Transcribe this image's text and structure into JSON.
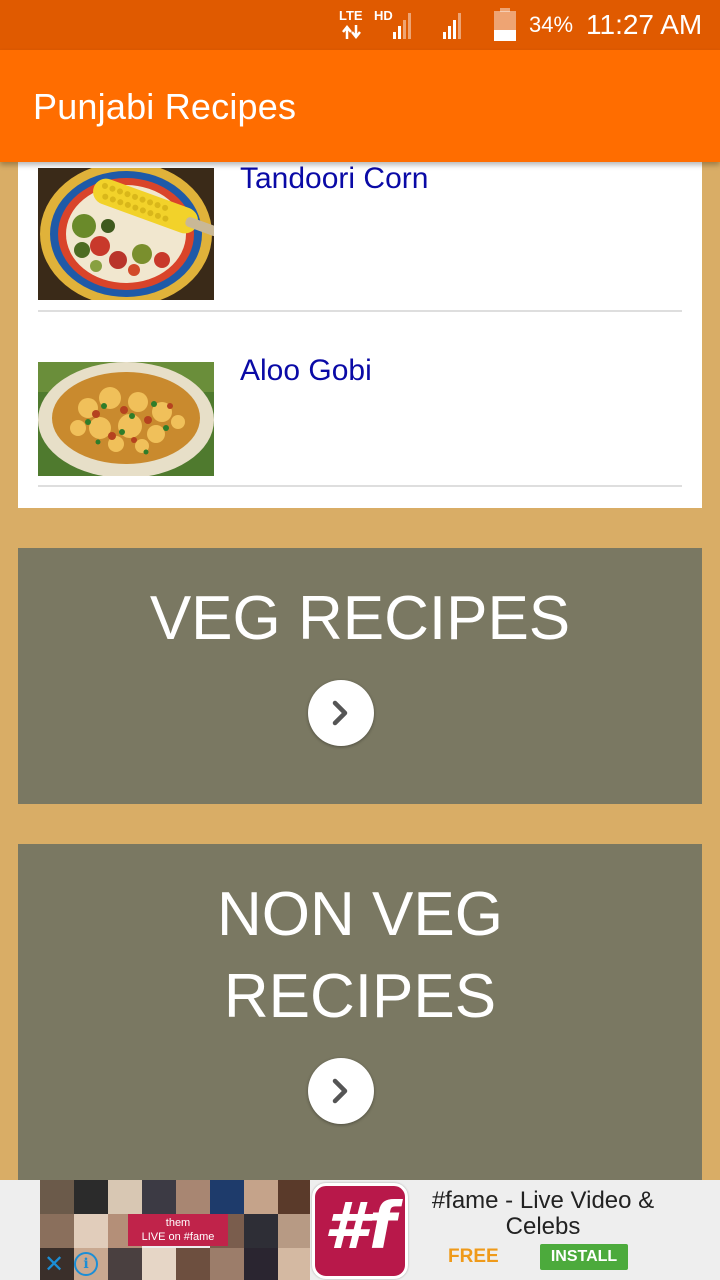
{
  "status_bar": {
    "network_type": "LTE",
    "hd_label": "HD",
    "battery_percent": "34%",
    "time": "11:27 AM",
    "icons": [
      "lte-data-icon",
      "signal-icon",
      "signal-icon",
      "battery-icon"
    ]
  },
  "app_bar": {
    "title": "Punjabi Recipes"
  },
  "recipe_list": {
    "items": [
      {
        "title": "Tandoori Corn",
        "thumbnail": "tandoori-corn-photo"
      },
      {
        "title": "Aloo Gobi",
        "thumbnail": "aloo-gobi-photo"
      }
    ]
  },
  "categories": [
    {
      "title": "VEG RECIPES",
      "button_icon": "chevron-right-icon"
    },
    {
      "title_line1": "NON VEG",
      "title_line2": "RECIPES",
      "button_icon": "chevron-right-icon"
    }
  ],
  "ad": {
    "collage_text_line1": "them",
    "collage_text_line2": "LIVE on #fame",
    "app_icon_letter": "#f",
    "headline": "#fame - Live Video & Celebs",
    "price": "FREE",
    "cta": "INSTALL",
    "close_glyph": "✕",
    "info_glyph": "i"
  },
  "colors": {
    "status_bar": "#e05a00",
    "app_bar": "#ff6d00",
    "background": "#d9ad66",
    "category_panel": "#7a7862",
    "recipe_title": "#0a0aa6",
    "install_button": "#4caa3c"
  }
}
